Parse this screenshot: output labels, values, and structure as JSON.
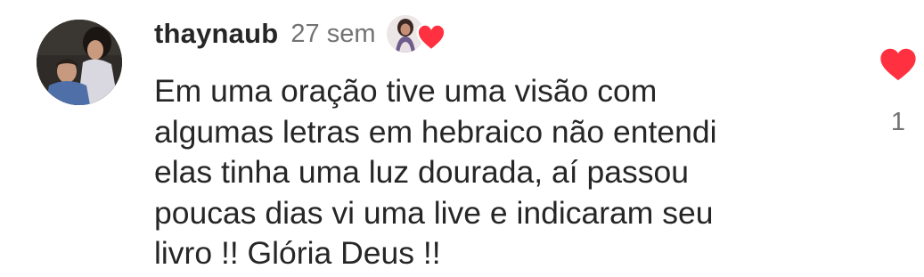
{
  "comment": {
    "username": "thaynaub",
    "timestamp": "27 sem",
    "text": "Em uma oração tive uma visão com\nalgumas letras em hebraico não entendi\nelas tinha uma luz dourada, aí passou\npoucas dias vi uma live e indicaram seu\nlivro !! Glória Deus !!",
    "like_count": "1",
    "liked_by_creator": true,
    "heart_color": "#ff3040",
    "icons": [
      "avatar",
      "creator-avatar",
      "heart-icon"
    ]
  }
}
